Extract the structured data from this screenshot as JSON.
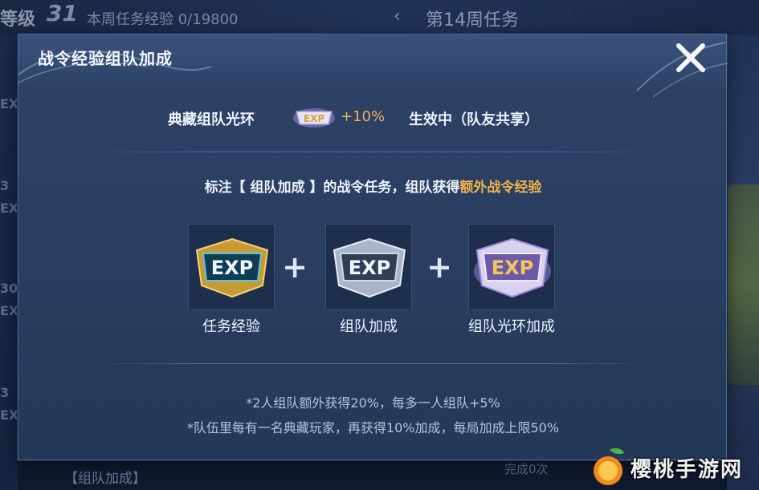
{
  "background": {
    "level_label": "等级",
    "level_value": "31",
    "weekly_exp": "本周任务经验 0/19800",
    "back_arrow": "chevron-left-icon",
    "week_title": "第14周任务",
    "left_labels": [
      "EX",
      "3",
      "EX",
      "30",
      "EX",
      "3",
      "EX"
    ],
    "bottom_task": "【组队加成】",
    "bottom_done": "完成0次"
  },
  "dialog": {
    "title": "战令经验组队加成",
    "close_icon": "close-icon",
    "aura": {
      "label": "典藏组队光环",
      "badge_text": "EXP",
      "percent": "+10%",
      "status": "生效中（队友共享）"
    },
    "description": {
      "prefix": "标注【 组队加成 】的战令任务，组队获得",
      "highlight": "额外战令经验"
    },
    "cards": [
      {
        "badge": "EXP",
        "label": "任务经验"
      },
      {
        "badge": "EXP",
        "label": "组队加成"
      },
      {
        "badge": "EXP",
        "label": "组队光环加成"
      }
    ],
    "plus_sign": "+",
    "notes": [
      "*2人组队额外获得20%，每多一人组队+5%",
      "*队伍里每有一名典藏玩家，再获得10%加成，每局加成上限50%"
    ]
  },
  "watermark": {
    "text": "樱桃手游网"
  },
  "colors": {
    "highlight": "#f2b44a",
    "percent": "#e9b45c",
    "dialog_bg": "#2a3f62"
  }
}
